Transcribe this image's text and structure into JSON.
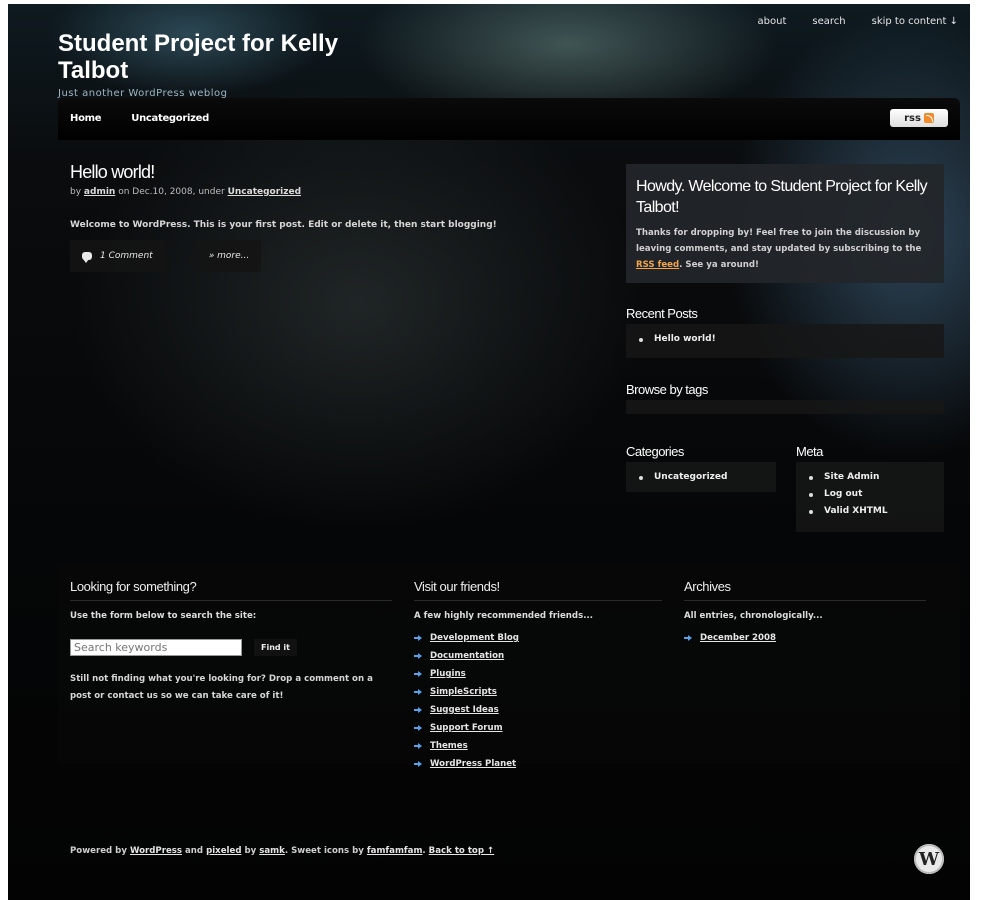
{
  "header": {
    "site_title": "Student Project for Kelly Talbot",
    "tagline": "Just another WordPress weblog",
    "top_links": [
      "about",
      "search",
      "skip to content ↓"
    ]
  },
  "nav": {
    "items": [
      "Home",
      "Uncategorized"
    ],
    "rss_label": "rss"
  },
  "post": {
    "title": "Hello world!",
    "meta": {
      "by": "by",
      "author": "admin",
      "on_date": "on Dec.10, 2008, under",
      "category": "Uncategorized"
    },
    "body": "Welcome to WordPress. This is your first post. Edit or delete it, then start blogging!",
    "comment_button": "1 Comment",
    "more_button": "» more..."
  },
  "sidebar": {
    "welcome_title": "Howdy. Welcome to Student Project for Kelly Talbot!",
    "welcome_text_1": "Thanks for dropping by! Feel free to join the discussion by leaving comments, and stay updated by subscribing to the",
    "welcome_link": "RSS feed",
    "welcome_text_2": ". See ya around!",
    "recent_posts_title": "Recent Posts",
    "recent_posts": [
      "Hello world!"
    ],
    "tags_title": "Browse by tags",
    "categories_title": "Categories",
    "categories": [
      "Uncategorized"
    ],
    "meta_title": "Meta",
    "meta_links": [
      "Site Admin",
      "Log out",
      "Valid XHTML"
    ]
  },
  "footer": {
    "search": {
      "title": "Looking for something?",
      "subtitle": "Use the form below to search the site:",
      "placeholder": "Search keywords",
      "button": "Find it",
      "note": "Still not finding what you're looking for? Drop a comment on a post or contact us so we can take care of it!"
    },
    "friends": {
      "title": "Visit our friends!",
      "subtitle": "A few highly recommended friends...",
      "links": [
        "Development Blog",
        "Documentation",
        "Plugins",
        "SimpleScripts",
        "Suggest Ideas",
        "Support Forum",
        "Themes",
        "WordPress Planet"
      ]
    },
    "archives": {
      "title": "Archives",
      "subtitle": "All entries, chronologically...",
      "links": [
        "December 2008"
      ]
    },
    "credits": {
      "powered_by": "Powered by",
      "wordpress": "WordPress",
      "and": "and",
      "pixeled": "pixeled",
      "by": "by",
      "samk": "samk",
      "icons": ". Sweet icons by",
      "famfamfam": "famfamfam",
      "back_to_top": "Back to top ↑"
    }
  }
}
